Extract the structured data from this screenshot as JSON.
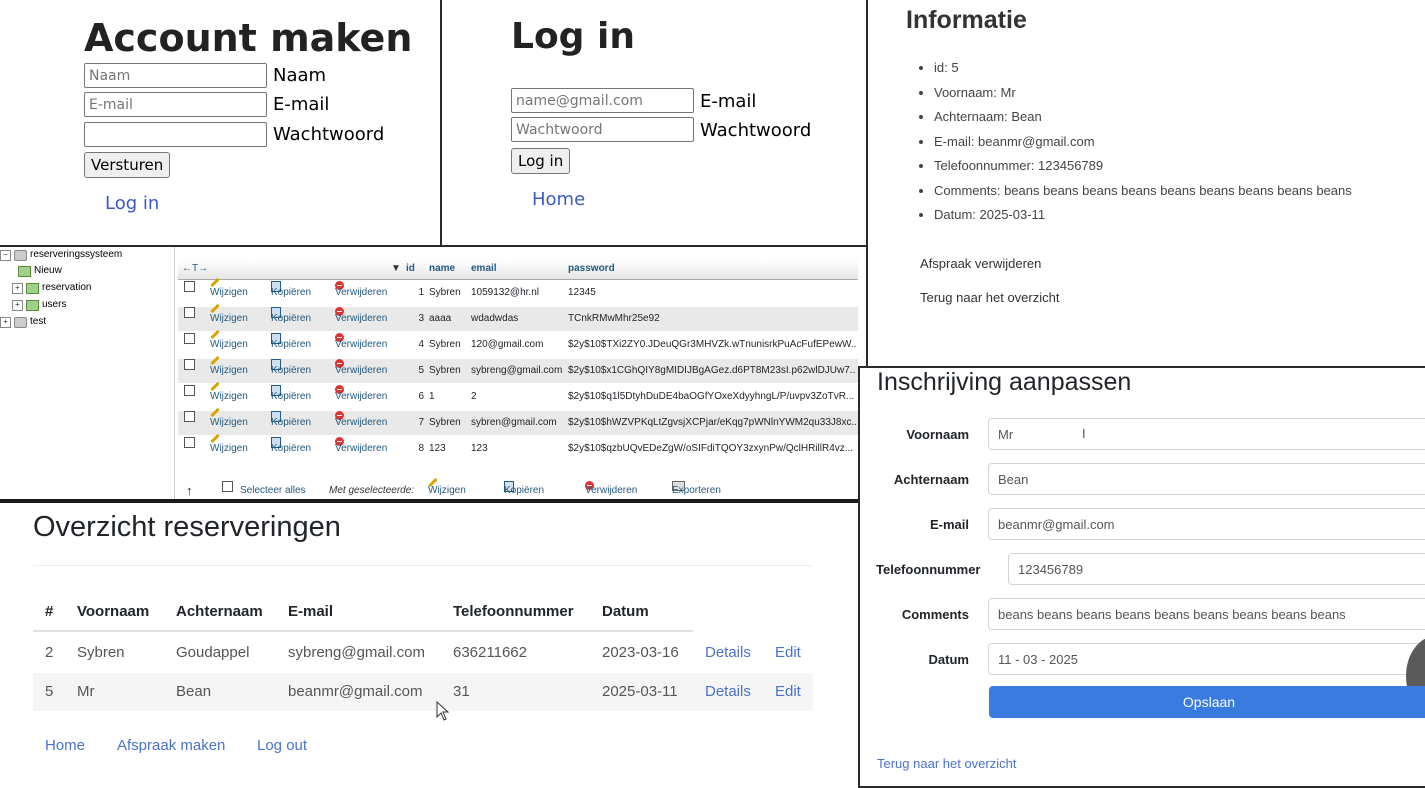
{
  "account": {
    "title": "Account maken",
    "name_placeholder": "Naam",
    "name_label": "Naam",
    "email_placeholder": "E-mail",
    "email_label": "E-mail",
    "password_label": "Wachtwoord",
    "submit_label": "Versturen",
    "login_link": "Log in"
  },
  "login": {
    "title": "Log in",
    "email_placeholder": "name@gmail.com",
    "email_label": "E-mail",
    "password_placeholder": "Wachtwoord",
    "password_label": "Wachtwoord",
    "submit_label": "Log in",
    "home_link": "Home"
  },
  "info": {
    "title": "Informatie",
    "items": [
      "id: 5",
      "Voornaam: Mr",
      "Achternaam: Bean",
      "E-mail: beanmr@gmail.com",
      "Telefoonnummer: 123456789",
      "Comments: beans beans beans beans beans beans beans beans beans",
      "Datum: 2025-03-11"
    ],
    "delete_link": "Afspraak verwijderen",
    "back_link": "Terug naar het overzicht"
  },
  "pma": {
    "tree": {
      "database": "reserveringssysteem",
      "new": "Nieuw",
      "tables": [
        "reservation",
        "users"
      ],
      "other_db": "test"
    },
    "nav_arrows": "←T→",
    "sort_icon": "▼",
    "columns": [
      "id",
      "name",
      "email",
      "password"
    ],
    "actions": {
      "edit": "Wijzigen",
      "copy": "Kopiëren",
      "delete": "Verwijderen"
    },
    "rows": [
      {
        "id": "1",
        "name": "Sybren",
        "email": "1059132@hr.nl",
        "password": "12345"
      },
      {
        "id": "3",
        "name": "aaaa",
        "email": "wdadwdas",
        "password": "TCnkRMwMhr25e92"
      },
      {
        "id": "4",
        "name": "Sybren",
        "email": "120@gmail.com",
        "password": "$2y$10$TXi2ZY0.JDeuQGr3MHVZk.wTnunisrkPuAcFufEPewW..."
      },
      {
        "id": "5",
        "name": "Sybren",
        "email": "sybreng@gmail.com",
        "password": "$2y$10$x1CGhQIY8gMIDIJBgAGez.d6PT8M23sI.p62wlDJUw7..."
      },
      {
        "id": "6",
        "name": "1",
        "email": "2",
        "password": "$2y$10$q1l5DtyhDuDE4baOGfYOxeXdyyhngL/P/uvpv3ZoTvR..."
      },
      {
        "id": "7",
        "name": "Sybren",
        "email": "sybren@gmail.com",
        "password": "$2y$10$hWZVPKqLtZgvsjXCPjar/eKqg7pWNlnYWM2qu33J8xc..."
      },
      {
        "id": "8",
        "name": "123",
        "email": "123",
        "password": "$2y$10$qzbUQvEDeZgW/oSIFdiTQOY3zxynPw/QclHRillR4vz..."
      }
    ],
    "footer": {
      "up_arrow": "↑",
      "select_all": "Selecteer alles",
      "with_selected": "Met geselecteerde:",
      "edit": "Wijzigen",
      "copy": "Kopiëren",
      "delete": "Verwijderen",
      "export": "Exporteren"
    }
  },
  "overview": {
    "title": "Overzicht reserveringen",
    "headers": [
      "#",
      "Voornaam",
      "Achternaam",
      "E-mail",
      "Telefoonnummer",
      "Datum"
    ],
    "rows": [
      {
        "num": "2",
        "first": "Sybren",
        "last": "Goudappel",
        "email": "sybreng@gmail.com",
        "phone": "636211662",
        "date": "2023-03-16",
        "details": "Details",
        "edit": "Edit"
      },
      {
        "num": "5",
        "first": "Mr",
        "last": "Bean",
        "email": "beanmr@gmail.com",
        "phone": "31",
        "date": "2025-03-11",
        "details": "Details",
        "edit": "Edit"
      }
    ],
    "footer_links": [
      "Home",
      "Afspraak maken",
      "Log out"
    ]
  },
  "edit": {
    "title": "Inschrijving aanpassen",
    "fields": [
      {
        "label": "Voornaam",
        "value": "Mr"
      },
      {
        "label": "Achternaam",
        "value": "Bean"
      },
      {
        "label": "E-mail",
        "value": "beanmr@gmail.com"
      },
      {
        "label": "Telefoonnummer",
        "value": "123456789"
      },
      {
        "label": "Comments",
        "value": "beans beans beans beans beans beans beans beans beans"
      },
      {
        "label": "Datum",
        "value": "11 - 03 - 2025"
      }
    ],
    "save_label": "Opslaan",
    "back_link": "Terug naar het overzicht"
  },
  "colors": {
    "link_blue": "#4a73c9",
    "primary_button": "#3a7be0",
    "pma_link": "#235a81"
  }
}
